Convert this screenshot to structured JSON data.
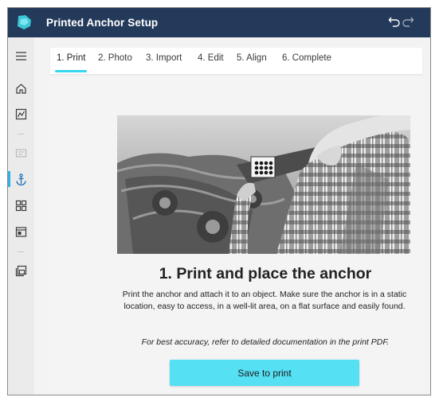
{
  "app": {
    "title": "Printed Anchor Setup",
    "logo_icon": "guides-logo-icon",
    "header_color": "#243a5a",
    "accent_color": "#35d6ee"
  },
  "toolbar": {
    "undo_icon": "undo-icon",
    "redo_icon": "redo-icon"
  },
  "sidebar": {
    "items": [
      {
        "name": "menu",
        "icon": "hamburger-icon"
      },
      {
        "name": "home",
        "icon": "home-icon"
      },
      {
        "name": "analytics",
        "icon": "chart-icon"
      },
      {
        "name": "outline",
        "icon": "outline-icon",
        "disabled": true
      },
      {
        "name": "anchor",
        "icon": "anchor-icon",
        "active": true
      },
      {
        "name": "steps",
        "icon": "grid-icon"
      },
      {
        "name": "preview",
        "icon": "preview-icon"
      },
      {
        "name": "save",
        "icon": "save-icon"
      }
    ]
  },
  "tabs": [
    {
      "label": "1. Print",
      "active": true
    },
    {
      "label": "2. Photo"
    },
    {
      "label": "3. Import"
    },
    {
      "label": "4. Edit"
    },
    {
      "label": "5. Align"
    },
    {
      "label": "6. Complete"
    }
  ],
  "main": {
    "heading": "1. Print and place the anchor",
    "description": "Print the anchor and attach it to an object. Make sure the anchor is in a static location, easy to access, in a well-lit area, on a flat surface and easily found.",
    "note": "For best accuracy, refer to detailed documentation in the print PDF.",
    "button_label": "Save to print",
    "button_color": "#56e0f4"
  }
}
